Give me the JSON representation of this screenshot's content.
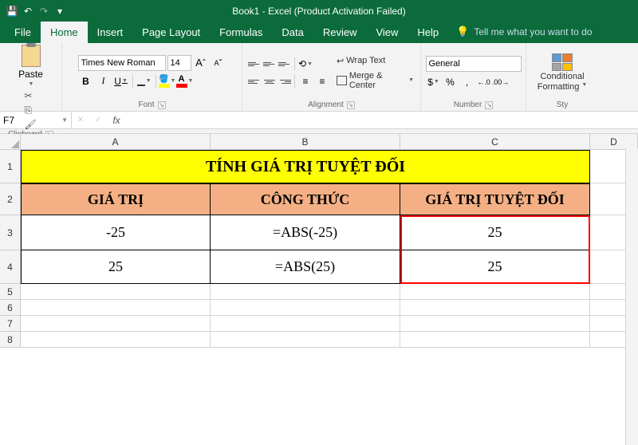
{
  "title": "Book1 - Excel (Product Activation Failed)",
  "qat": {
    "save": "💾",
    "undo": "↶",
    "redo": "↷"
  },
  "menu": {
    "file": "File",
    "home": "Home",
    "insert": "Insert",
    "page_layout": "Page Layout",
    "formulas": "Formulas",
    "data": "Data",
    "review": "Review",
    "view": "View",
    "help": "Help",
    "tell_me": "Tell me what you want to do"
  },
  "ribbon": {
    "clipboard": {
      "paste": "Paste",
      "label": "Clipboard"
    },
    "font": {
      "name": "Times New Roman",
      "size": "14",
      "bold": "B",
      "italic": "I",
      "underline": "U",
      "label": "Font",
      "grow": "A",
      "shrink": "A"
    },
    "alignment": {
      "wrap": "Wrap Text",
      "merge": "Merge & Center",
      "label": "Alignment"
    },
    "number": {
      "format": "General",
      "label": "Number",
      "currency": "$",
      "percent": "%",
      "comma": ",",
      "inc": ".0",
      "dec": ".00"
    },
    "styles": {
      "cond": "Conditional",
      "fmt": "Formatting",
      "label": "Sty"
    }
  },
  "namebox": "F7",
  "formula": "",
  "cols": {
    "A": "A",
    "B": "B",
    "C": "C",
    "D": "D"
  },
  "sheet": {
    "title": "TÍNH GIÁ TRỊ TUYỆT ĐỐI",
    "headers": {
      "a": "GIÁ TRỊ",
      "b": "CÔNG THỨC",
      "c": "GIÁ TRỊ TUYỆT ĐỐI"
    },
    "rows": [
      {
        "a": "-25",
        "b": "=ABS(-25)",
        "c": "25"
      },
      {
        "a": "25",
        "b": "=ABS(25)",
        "c": "25"
      }
    ]
  }
}
